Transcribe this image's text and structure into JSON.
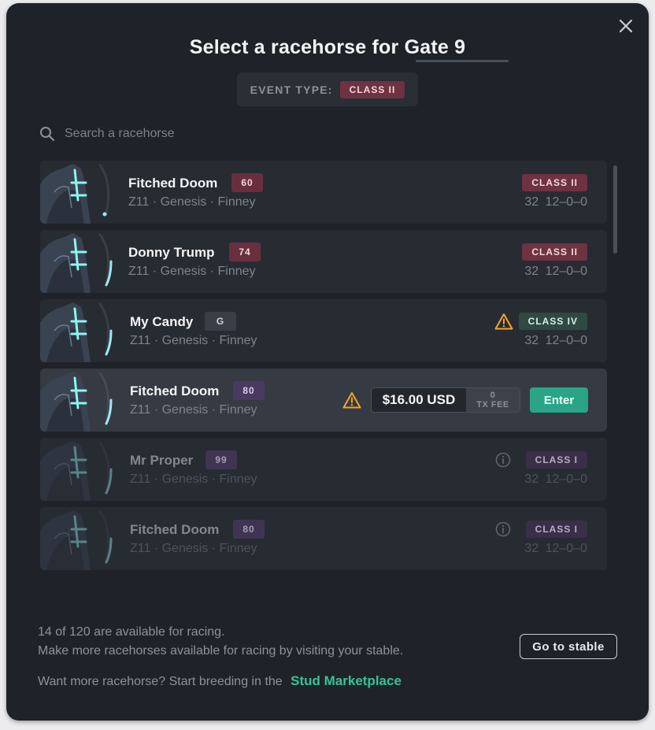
{
  "modal": {
    "title": "Select a racehorse for Gate 9",
    "event_type_label": "EVENT TYPE:",
    "event_type_value": "CLASS II"
  },
  "search": {
    "placeholder": "Search a racehorse"
  },
  "horses": [
    {
      "name": "Fitched Doom",
      "rating": "60",
      "details": "Z11 · Genesis · Finney",
      "class": "CLASS II",
      "stats": "32 12–0–0"
    },
    {
      "name": "Donny Trump",
      "rating": "74",
      "details": "Z11 · Genesis · Finney",
      "class": "CLASS II",
      "stats": "32 12–0–0"
    },
    {
      "name": "My Candy",
      "rating": "G",
      "details": "Z11 · Genesis · Finney",
      "class": "CLASS IV",
      "stats": "32 12–0–0"
    },
    {
      "name": "Fitched Doom",
      "rating": "80",
      "details": "Z11 · Genesis · Finney",
      "price": "$16.00 USD",
      "fee_value": "0",
      "fee_label": "TX FEE",
      "enter_label": "Enter"
    },
    {
      "name": "Mr Proper",
      "rating": "99",
      "details": "Z11 · Genesis · Finney",
      "class": "CLASS I",
      "stats": "32 12–0–0"
    },
    {
      "name": "Fitched Doom",
      "rating": "80",
      "details": "Z11 · Genesis · Finney",
      "class": "CLASS I",
      "stats": "32 12–0–0"
    }
  ],
  "footer": {
    "availability": "14 of 120 are available for racing.",
    "hint": "Make more racehorses available for racing by visiting your stable.",
    "stable_button": "Go to stable",
    "breeding_text": "Want more racehorse? Start breeding in the",
    "marketplace_link": "Stud Marketplace"
  },
  "colors": {
    "accent": "#2aa486",
    "class_ii": "#6e3241",
    "class_iv": "#2f4a43",
    "class_i": "#3a2f48",
    "warning": "#f5a623"
  },
  "icons": [
    "close-icon",
    "search-icon",
    "warning-icon",
    "info-icon",
    "horse-avatar"
  ]
}
